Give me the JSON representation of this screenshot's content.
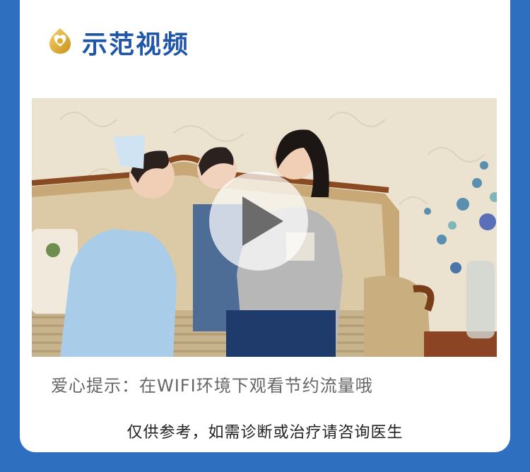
{
  "section": {
    "title": "示范视频",
    "icon": "heart-badge-icon"
  },
  "video": {
    "thumbnail_alt": "视频封面",
    "play_icon": "play-icon"
  },
  "tip_text": "爱心提示：在WIFI环境下观看节约流量哦",
  "disclaimer": "仅供参考，如需诊断或治疗请咨询医生",
  "colors": {
    "background": "#2f6fc0",
    "title": "#1f56a8",
    "card": "#ffffff",
    "tip": "#666666"
  }
}
